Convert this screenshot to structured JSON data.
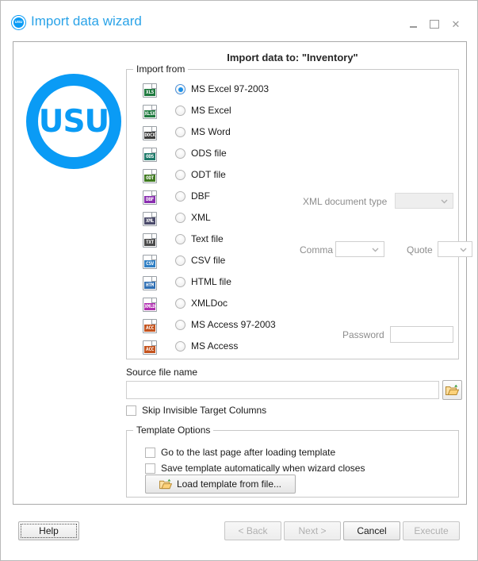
{
  "window": {
    "title": "Import data wizard",
    "logo_text": "USU",
    "icon": "usu-logo-icon",
    "accent_color": "#0a9bf5",
    "title_color": "#2aa3e8",
    "controls": {
      "minimize": "minimize-icon",
      "maximize": "maximize-icon",
      "close": "close-icon",
      "close_glyph": "✕"
    }
  },
  "main": {
    "page_title": "Import data to: \"Inventory\"",
    "import_from_legend": "Import from",
    "formats": [
      {
        "label": "MS Excel 97-2003",
        "icon": "xls-file-icon",
        "tag": "XLS",
        "tag_color": "#1f7a3f",
        "selected": true
      },
      {
        "label": "MS Excel",
        "icon": "xlsx-file-icon",
        "tag": "XLSX",
        "tag_color": "#1f7a3f",
        "selected": false
      },
      {
        "label": "MS Word",
        "icon": "docx-file-icon",
        "tag": "DOCX",
        "tag_color": "#3a3a3a",
        "selected": false
      },
      {
        "label": "ODS file",
        "icon": "ods-file-icon",
        "tag": "ODS",
        "tag_color": "#1f7a6a",
        "selected": false
      },
      {
        "label": "ODT file",
        "icon": "odt-file-icon",
        "tag": "ODT",
        "tag_color": "#3f7a1f",
        "selected": false
      },
      {
        "label": "DBF",
        "icon": "dbf-file-icon",
        "tag": "DBF",
        "tag_color": "#8a2fb0",
        "selected": false
      },
      {
        "label": "XML",
        "icon": "xml-file-icon",
        "tag": "XML",
        "tag_color": "#4a4a6a",
        "selected": false
      },
      {
        "label": "Text file",
        "icon": "txt-file-icon",
        "tag": "TXT",
        "tag_color": "#4a4a4a",
        "selected": false
      },
      {
        "label": "CSV file",
        "icon": "csv-file-icon",
        "tag": "CSV",
        "tag_color": "#2f7fc4",
        "selected": false
      },
      {
        "label": "HTML file",
        "icon": "html-file-icon",
        "tag": "HTM",
        "tag_color": "#2f6fb4",
        "selected": false
      },
      {
        "label": "XMLDoc",
        "icon": "xmldoc-file-icon",
        "tag": "XMLD",
        "tag_color": "#b02fb0",
        "selected": false
      },
      {
        "label": "MS Access 97-2003",
        "icon": "mdb-file-icon",
        "tag": "ACC",
        "tag_color": "#c4541f",
        "selected": false
      },
      {
        "label": "MS Access",
        "icon": "accdb-file-icon",
        "tag": "ACC",
        "tag_color": "#c4541f",
        "selected": false
      }
    ],
    "xml_document_type": {
      "label": "XML document type",
      "value": "",
      "enabled": false
    },
    "comma": {
      "label": "Comma",
      "value": "",
      "enabled": false
    },
    "quote": {
      "label": "Quote",
      "value": "",
      "enabled": false
    },
    "password": {
      "label": "Password",
      "value": "",
      "placeholder": ""
    }
  },
  "source": {
    "label": "Source file name",
    "value": "",
    "placeholder": "",
    "browse_icon": "open-folder-icon"
  },
  "skip_columns": {
    "label": "Skip Invisible Target Columns",
    "checked": false
  },
  "template_options": {
    "legend": "Template Options",
    "goto_last_page": {
      "label": "Go to the last page after loading template",
      "checked": false
    },
    "save_automatically": {
      "label": "Save template automatically when wizard closes",
      "checked": false
    },
    "load_button": {
      "label": "Load template from file...",
      "icon": "open-folder-icon"
    }
  },
  "footer": {
    "help": {
      "label": "Help",
      "enabled": true,
      "focused": true
    },
    "back": {
      "label": "< Back",
      "enabled": false
    },
    "next": {
      "label": "Next >",
      "enabled": false
    },
    "cancel": {
      "label": "Cancel",
      "enabled": true
    },
    "execute": {
      "label": "Execute",
      "enabled": false
    }
  }
}
